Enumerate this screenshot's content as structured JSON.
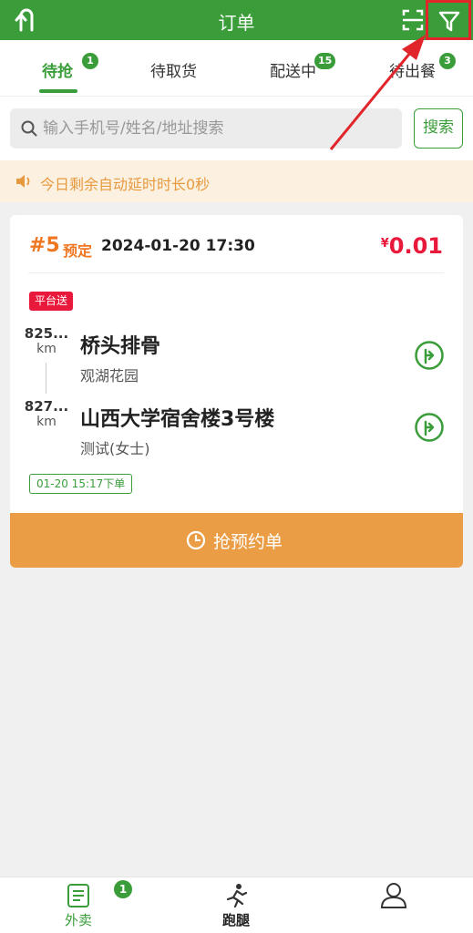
{
  "header": {
    "title": "订单"
  },
  "tabs": [
    {
      "label": "待抢",
      "badge": "1",
      "active": true
    },
    {
      "label": "待取货",
      "badge": "",
      "active": false
    },
    {
      "label": "配送中",
      "badge": "15",
      "active": false
    },
    {
      "label": "待出餐",
      "badge": "3",
      "active": false
    }
  ],
  "search": {
    "placeholder": "输入手机号/姓名/地址搜索",
    "value": "",
    "button_label": "搜索"
  },
  "notice": {
    "text": "今日剩余自动延时时长0秒"
  },
  "order": {
    "number": "#5",
    "tag": "预定",
    "time": "2024-01-20 17:30",
    "currency": "¥",
    "price": "0.01",
    "delivery_tag": "平台送",
    "pickup": {
      "distance": "825...",
      "unit": "km",
      "name": "桥头排骨",
      "sub": "观湖花园"
    },
    "dropoff": {
      "distance": "827...",
      "unit": "km",
      "name": "山西大学宿舍楼3号楼",
      "sub": "测试(女士)"
    },
    "order_time_tag": "01-20 15:17下单",
    "grab_button_label": "抢预约单"
  },
  "bottom_nav": [
    {
      "label": "外卖",
      "badge": "1",
      "icon": "list-icon"
    },
    {
      "label": "跑腿",
      "badge": "",
      "icon": "runner-icon"
    },
    {
      "label": "",
      "badge": "",
      "icon": "user-icon"
    }
  ],
  "colors": {
    "primary": "#3a9d3a",
    "accent_orange": "#f07722",
    "price_red": "#e8193b",
    "grab_button": "#ea9d45",
    "notice_bg": "#fcf1e0",
    "highlight_red": "#e0262b"
  }
}
